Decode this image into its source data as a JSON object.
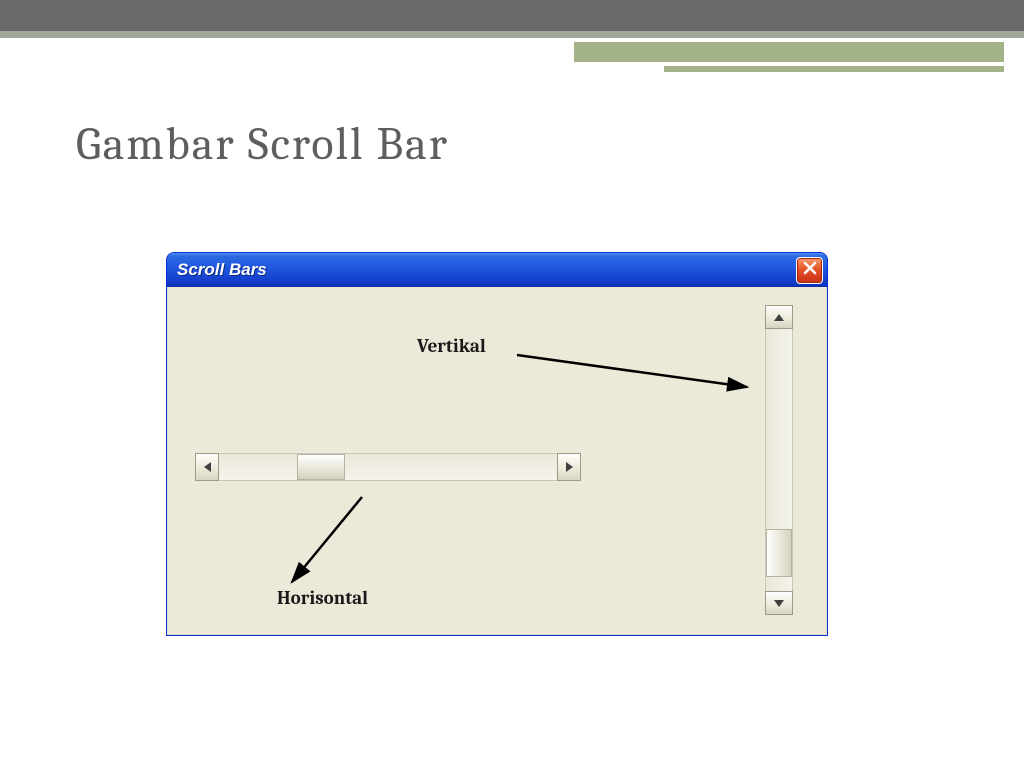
{
  "slide": {
    "title": "Gambar Scroll Bar"
  },
  "window": {
    "title": "Scroll Bars"
  },
  "annotations": {
    "vertical_label": "Vertikal",
    "horizontal_label": "Horisontal"
  }
}
